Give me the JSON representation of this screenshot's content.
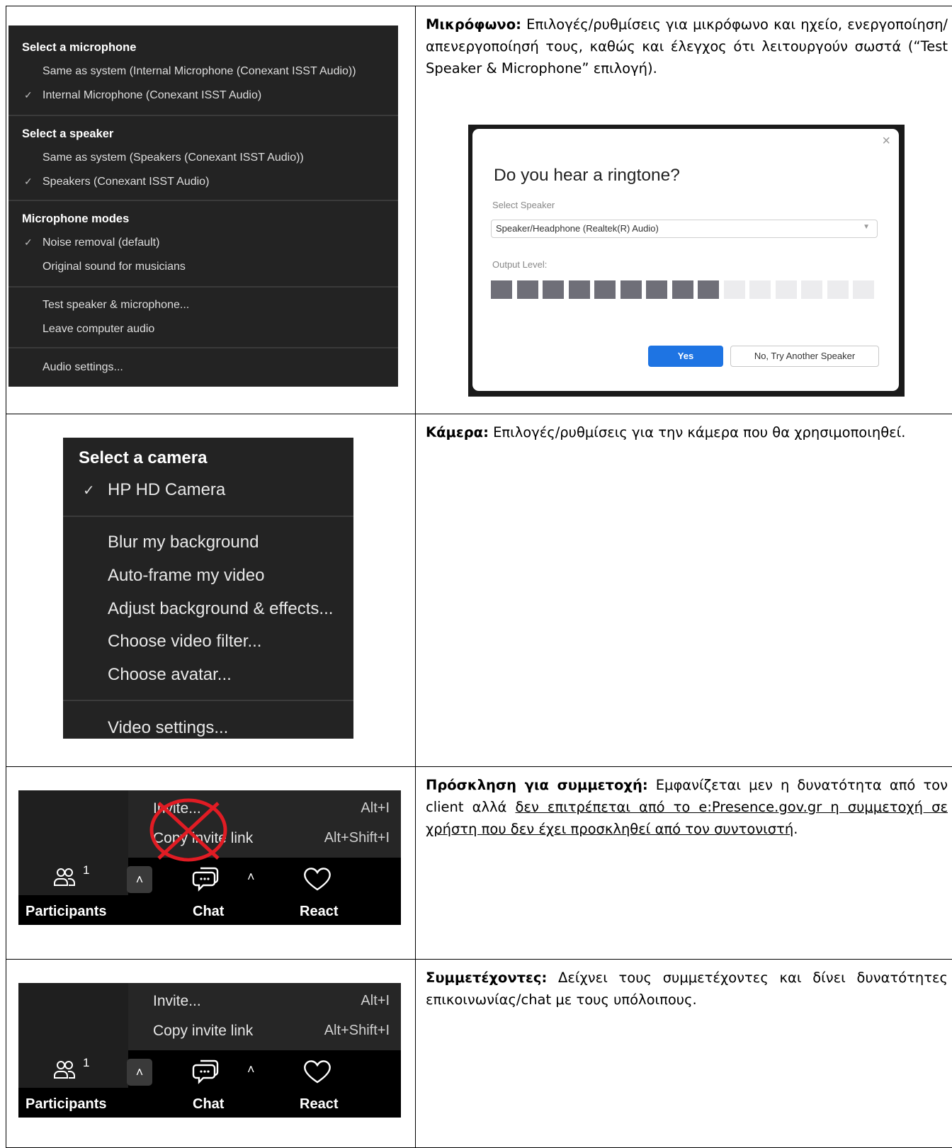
{
  "rows": [
    {
      "heading": "Μικρόφωνο:",
      "text": " Επιλογές/ρυθμίσεις για μικρόφωνο και ηχείο, ενεργοποίηση/απενεργοποίησή τους, καθώς και έλεγχος ότι λειτουργούν σωστά (“Test Speaker & Microphone” επιλογή)."
    },
    {
      "heading": "Κάμερα:",
      "text": " Επιλογές/ρυθμίσεις για την κάμερα που θα χρησιμοποιηθεί."
    },
    {
      "heading": "Πρόσκληση για συμμετοχή:",
      "text": " Εμφανίζεται μεν η δυνατότητα από τον client αλλά ",
      "underlined": "δεν επιτρέπεται από το e:Presence.gov.gr η συμμετοχή σε χρήστη που δεν έχει προσκληθεί από τον συντονιστή",
      "after": "."
    },
    {
      "heading": "Συμμετέχοντες:",
      "text": " Δείχνει τους συμμετέχοντες και δίνει δυνατότητες επικοινωνίας/chat με τους υπόλοιπους."
    }
  ],
  "audio_menu": {
    "mic_header": "Select a microphone",
    "mic_items": [
      "Same as system (Internal Microphone (Conexant ISST Audio))",
      "Internal Microphone (Conexant ISST Audio)"
    ],
    "speaker_header": "Select a speaker",
    "speaker_items": [
      "Same as system (Speakers (Conexant ISST Audio))",
      "Speakers (Conexant ISST Audio)"
    ],
    "modes_header": "Microphone modes",
    "mode_items": [
      "Noise removal (default)",
      "Original sound for musicians"
    ],
    "test": "Test speaker & microphone...",
    "leave": "Leave computer audio",
    "settings": "Audio settings..."
  },
  "ringtone_dialog": {
    "close": "×",
    "title": "Do you hear a ringtone?",
    "select_label": "Select Speaker",
    "select_value": "Speaker/Headphone (Realtek(R) Audio)",
    "output_label": "Output Level:",
    "output_level": 0.6,
    "yes": "Yes",
    "no": "No, Try Another Speaker"
  },
  "camera_menu": {
    "header": "Select a camera",
    "camera": "HP HD Camera",
    "items": [
      "Blur my background",
      "Auto-frame my video",
      "Adjust background & effects...",
      "Choose video filter...",
      "Choose avatar..."
    ],
    "settings": "Video settings..."
  },
  "toolbar": {
    "invite": "Invite...",
    "invite_shortcut": "Alt+I",
    "copy_link": "Copy invite link",
    "copy_shortcut": "Alt+Shift+I",
    "participants_count": "1",
    "participants": "Participants",
    "chat": "Chat",
    "react": "React"
  },
  "colors": {
    "menu_bg": "#232323",
    "accent_blue": "#1e74e3",
    "cross_red": "#e01c24"
  }
}
